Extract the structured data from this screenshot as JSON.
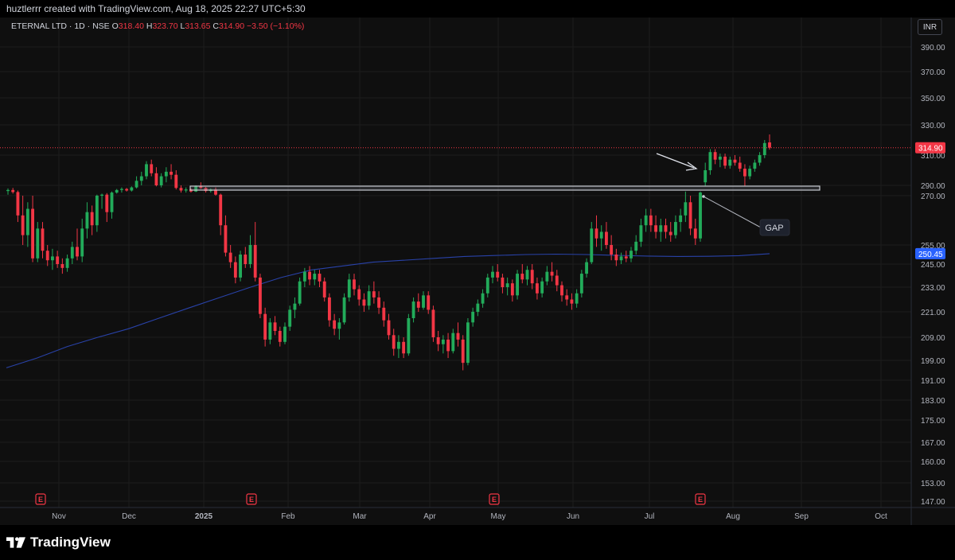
{
  "attribution": "huztlerrr created with TradingView.com, Aug 18, 2025 22:27 UTC+5:30",
  "legend": {
    "symbol": "ETERNAL LTD · 1D · NSE",
    "o_label": "O",
    "o_value": "318.40",
    "h_label": "H",
    "h_value": "323.70",
    "l_label": "L",
    "l_value": "313.65",
    "c_label": "C",
    "c_value": "314.90",
    "change": "−3.50 (−1.10%)"
  },
  "currency_button": "INR",
  "brand": {
    "name": "TradingView",
    "logo_icon": "tradingview-logo-icon"
  },
  "colors": {
    "up": "#26a69a",
    "up_bright": "#22ab5a",
    "down": "#f23645",
    "ma": "#2962ff",
    "price_label": "#f23645",
    "ma_label": "#2962ff",
    "grid": "#1c1c1c",
    "text": "#b2b5be"
  },
  "chart_data": {
    "type": "candlestick",
    "price_axis": {
      "ticks": [
        390,
        370,
        350,
        330,
        310,
        290,
        270,
        255,
        245,
        233,
        221,
        209,
        199,
        191,
        183,
        175,
        167,
        160,
        153,
        147
      ],
      "tick_labels": [
        "390.00",
        "370.00",
        "350.00",
        "330.00",
        "310.00",
        "290.00",
        "270.00",
        "255.00",
        "245.00",
        "233.00",
        "221.00",
        "209.00",
        "199.00",
        "191.00",
        "183.00",
        "175.00",
        "167.00",
        "160.00",
        "153.00",
        "147.00"
      ],
      "scale": "log"
    },
    "time_axis": {
      "labels": [
        "Nov",
        "Dec",
        "2025",
        "Feb",
        "Mar",
        "Apr",
        "May",
        "Jun",
        "Jul",
        "Aug",
        "Sep",
        "Oct"
      ]
    },
    "last_price": 314.9,
    "last_price_label": "314.90",
    "ma_value": 250.45,
    "ma_label": "250.45",
    "earnings_markers": [
      "E",
      "E",
      "E",
      "E"
    ],
    "annotations": {
      "gap_label": "GAP"
    },
    "candles": [
      {
        "o": 279,
        "h": 284,
        "l": 272,
        "c": 281
      },
      {
        "o": 281,
        "h": 285,
        "l": 274,
        "c": 277
      },
      {
        "o": 277,
        "h": 280,
        "l": 262,
        "c": 264
      },
      {
        "o": 264,
        "h": 270,
        "l": 255,
        "c": 258
      },
      {
        "o": 258,
        "h": 268,
        "l": 254,
        "c": 266
      },
      {
        "o": 266,
        "h": 270,
        "l": 246,
        "c": 248
      },
      {
        "o": 248,
        "h": 262,
        "l": 246,
        "c": 260
      },
      {
        "o": 260,
        "h": 262,
        "l": 248,
        "c": 252
      },
      {
        "o": 252,
        "h": 255,
        "l": 244,
        "c": 247
      },
      {
        "o": 247,
        "h": 253,
        "l": 242,
        "c": 249
      },
      {
        "o": 249,
        "h": 252,
        "l": 243,
        "c": 245
      },
      {
        "o": 245,
        "h": 248,
        "l": 240,
        "c": 243
      },
      {
        "o": 243,
        "h": 250,
        "l": 241,
        "c": 248
      },
      {
        "o": 248,
        "h": 256,
        "l": 245,
        "c": 254
      },
      {
        "o": 254,
        "h": 260,
        "l": 247,
        "c": 249
      },
      {
        "o": 249,
        "h": 263,
        "l": 246,
        "c": 260
      },
      {
        "o": 260,
        "h": 268,
        "l": 257,
        "c": 265
      },
      {
        "o": 265,
        "h": 267,
        "l": 258,
        "c": 261
      },
      {
        "o": 261,
        "h": 272,
        "l": 259,
        "c": 270
      },
      {
        "o": 270,
        "h": 274,
        "l": 266,
        "c": 272
      },
      {
        "o": 272,
        "h": 275,
        "l": 262,
        "c": 265
      },
      {
        "o": 265,
        "h": 278,
        "l": 263,
        "c": 276
      },
      {
        "o": 276,
        "h": 283,
        "l": 274,
        "c": 281
      },
      {
        "o": 281,
        "h": 286,
        "l": 276,
        "c": 283
      },
      {
        "o": 283,
        "h": 285,
        "l": 278,
        "c": 280
      },
      {
        "o": 280,
        "h": 288,
        "l": 278,
        "c": 286
      },
      {
        "o": 286,
        "h": 296,
        "l": 284,
        "c": 293
      },
      {
        "o": 293,
        "h": 299,
        "l": 290,
        "c": 296
      },
      {
        "o": 296,
        "h": 306,
        "l": 294,
        "c": 304
      },
      {
        "o": 304,
        "h": 307,
        "l": 296,
        "c": 298
      },
      {
        "o": 298,
        "h": 302,
        "l": 288,
        "c": 290
      },
      {
        "o": 290,
        "h": 298,
        "l": 286,
        "c": 296
      },
      {
        "o": 296,
        "h": 302,
        "l": 292,
        "c": 299
      },
      {
        "o": 299,
        "h": 304,
        "l": 294,
        "c": 297
      },
      {
        "o": 297,
        "h": 300,
        "l": 282,
        "c": 285
      },
      {
        "o": 285,
        "h": 290,
        "l": 276,
        "c": 280
      },
      {
        "o": 280,
        "h": 286,
        "l": 276,
        "c": 282
      },
      {
        "o": 282,
        "h": 284,
        "l": 276,
        "c": 278
      },
      {
        "o": 278,
        "h": 290,
        "l": 277,
        "c": 288
      },
      {
        "o": 288,
        "h": 292,
        "l": 283,
        "c": 285
      },
      {
        "o": 285,
        "h": 287,
        "l": 276,
        "c": 279
      },
      {
        "o": 279,
        "h": 284,
        "l": 276,
        "c": 282
      },
      {
        "o": 282,
        "h": 286,
        "l": 270,
        "c": 272
      },
      {
        "o": 272,
        "h": 274,
        "l": 258,
        "c": 261
      },
      {
        "o": 261,
        "h": 264,
        "l": 249,
        "c": 251
      },
      {
        "o": 251,
        "h": 255,
        "l": 243,
        "c": 246
      },
      {
        "o": 246,
        "h": 249,
        "l": 235,
        "c": 238
      },
      {
        "o": 238,
        "h": 252,
        "l": 236,
        "c": 250
      },
      {
        "o": 250,
        "h": 254,
        "l": 243,
        "c": 245
      },
      {
        "o": 245,
        "h": 258,
        "l": 243,
        "c": 255
      },
      {
        "o": 255,
        "h": 262,
        "l": 236,
        "c": 238
      },
      {
        "o": 238,
        "h": 240,
        "l": 218,
        "c": 220
      },
      {
        "o": 220,
        "h": 223,
        "l": 205,
        "c": 208
      },
      {
        "o": 208,
        "h": 218,
        "l": 206,
        "c": 216
      },
      {
        "o": 216,
        "h": 219,
        "l": 210,
        "c": 212
      },
      {
        "o": 212,
        "h": 214,
        "l": 205,
        "c": 207
      },
      {
        "o": 207,
        "h": 216,
        "l": 206,
        "c": 214
      },
      {
        "o": 214,
        "h": 224,
        "l": 212,
        "c": 222
      },
      {
        "o": 222,
        "h": 228,
        "l": 218,
        "c": 225
      },
      {
        "o": 225,
        "h": 238,
        "l": 224,
        "c": 236
      },
      {
        "o": 236,
        "h": 243,
        "l": 233,
        "c": 241
      },
      {
        "o": 241,
        "h": 244,
        "l": 234,
        "c": 237
      },
      {
        "o": 237,
        "h": 242,
        "l": 234,
        "c": 240
      },
      {
        "o": 240,
        "h": 242,
        "l": 233,
        "c": 236
      },
      {
        "o": 236,
        "h": 238,
        "l": 226,
        "c": 228
      },
      {
        "o": 228,
        "h": 230,
        "l": 214,
        "c": 217
      },
      {
        "o": 217,
        "h": 220,
        "l": 210,
        "c": 213
      },
      {
        "o": 213,
        "h": 218,
        "l": 208,
        "c": 216
      },
      {
        "o": 216,
        "h": 230,
        "l": 215,
        "c": 228
      },
      {
        "o": 228,
        "h": 240,
        "l": 226,
        "c": 237
      },
      {
        "o": 237,
        "h": 240,
        "l": 229,
        "c": 232
      },
      {
        "o": 232,
        "h": 234,
        "l": 224,
        "c": 227
      },
      {
        "o": 227,
        "h": 230,
        "l": 221,
        "c": 224
      },
      {
        "o": 224,
        "h": 234,
        "l": 222,
        "c": 231
      },
      {
        "o": 231,
        "h": 236,
        "l": 225,
        "c": 228
      },
      {
        "o": 228,
        "h": 231,
        "l": 220,
        "c": 223
      },
      {
        "o": 223,
        "h": 226,
        "l": 214,
        "c": 217
      },
      {
        "o": 217,
        "h": 220,
        "l": 208,
        "c": 210
      },
      {
        "o": 210,
        "h": 213,
        "l": 201,
        "c": 204
      },
      {
        "o": 204,
        "h": 210,
        "l": 200,
        "c": 207
      },
      {
        "o": 207,
        "h": 209,
        "l": 200,
        "c": 202
      },
      {
        "o": 202,
        "h": 220,
        "l": 201,
        "c": 218
      },
      {
        "o": 218,
        "h": 228,
        "l": 216,
        "c": 226
      },
      {
        "o": 226,
        "h": 230,
        "l": 221,
        "c": 223
      },
      {
        "o": 223,
        "h": 231,
        "l": 222,
        "c": 229
      },
      {
        "o": 229,
        "h": 231,
        "l": 220,
        "c": 222
      },
      {
        "o": 222,
        "h": 224,
        "l": 207,
        "c": 209
      },
      {
        "o": 209,
        "h": 212,
        "l": 203,
        "c": 206
      },
      {
        "o": 206,
        "h": 210,
        "l": 202,
        "c": 208
      },
      {
        "o": 208,
        "h": 211,
        "l": 200,
        "c": 203
      },
      {
        "o": 203,
        "h": 213,
        "l": 202,
        "c": 211
      },
      {
        "o": 211,
        "h": 216,
        "l": 205,
        "c": 208
      },
      {
        "o": 208,
        "h": 210,
        "l": 195,
        "c": 198
      },
      {
        "o": 198,
        "h": 218,
        "l": 197,
        "c": 216
      },
      {
        "o": 216,
        "h": 223,
        "l": 214,
        "c": 221
      },
      {
        "o": 221,
        "h": 227,
        "l": 219,
        "c": 225
      },
      {
        "o": 225,
        "h": 232,
        "l": 223,
        "c": 230
      },
      {
        "o": 230,
        "h": 240,
        "l": 228,
        "c": 238
      },
      {
        "o": 238,
        "h": 244,
        "l": 235,
        "c": 241
      },
      {
        "o": 241,
        "h": 245,
        "l": 236,
        "c": 238
      },
      {
        "o": 238,
        "h": 240,
        "l": 230,
        "c": 233
      },
      {
        "o": 233,
        "h": 238,
        "l": 229,
        "c": 235
      },
      {
        "o": 235,
        "h": 237,
        "l": 226,
        "c": 229
      },
      {
        "o": 229,
        "h": 242,
        "l": 227,
        "c": 240
      },
      {
        "o": 240,
        "h": 245,
        "l": 235,
        "c": 237
      },
      {
        "o": 237,
        "h": 244,
        "l": 234,
        "c": 242
      },
      {
        "o": 242,
        "h": 245,
        "l": 232,
        "c": 235
      },
      {
        "o": 235,
        "h": 238,
        "l": 227,
        "c": 230
      },
      {
        "o": 230,
        "h": 238,
        "l": 228,
        "c": 236
      },
      {
        "o": 236,
        "h": 244,
        "l": 234,
        "c": 241
      },
      {
        "o": 241,
        "h": 246,
        "l": 236,
        "c": 239
      },
      {
        "o": 239,
        "h": 242,
        "l": 231,
        "c": 234
      },
      {
        "o": 234,
        "h": 236,
        "l": 226,
        "c": 229
      },
      {
        "o": 229,
        "h": 232,
        "l": 224,
        "c": 227
      },
      {
        "o": 227,
        "h": 230,
        "l": 222,
        "c": 225
      },
      {
        "o": 225,
        "h": 232,
        "l": 223,
        "c": 230
      },
      {
        "o": 230,
        "h": 242,
        "l": 228,
        "c": 240
      },
      {
        "o": 240,
        "h": 248,
        "l": 238,
        "c": 246
      },
      {
        "o": 246,
        "h": 262,
        "l": 245,
        "c": 260
      },
      {
        "o": 260,
        "h": 264,
        "l": 254,
        "c": 257
      },
      {
        "o": 257,
        "h": 261,
        "l": 252,
        "c": 259
      },
      {
        "o": 259,
        "h": 262,
        "l": 253,
        "c": 255
      },
      {
        "o": 255,
        "h": 258,
        "l": 247,
        "c": 250
      },
      {
        "o": 250,
        "h": 253,
        "l": 244,
        "c": 247
      },
      {
        "o": 247,
        "h": 251,
        "l": 245,
        "c": 249
      },
      {
        "o": 249,
        "h": 252,
        "l": 246,
        "c": 248
      },
      {
        "o": 248,
        "h": 254,
        "l": 246,
        "c": 252
      },
      {
        "o": 252,
        "h": 258,
        "l": 250,
        "c": 256
      },
      {
        "o": 256,
        "h": 263,
        "l": 254,
        "c": 261
      },
      {
        "o": 261,
        "h": 266,
        "l": 259,
        "c": 264
      },
      {
        "o": 264,
        "h": 266,
        "l": 259,
        "c": 261
      },
      {
        "o": 261,
        "h": 264,
        "l": 257,
        "c": 259
      },
      {
        "o": 259,
        "h": 263,
        "l": 256,
        "c": 261
      },
      {
        "o": 261,
        "h": 263,
        "l": 257,
        "c": 259
      },
      {
        "o": 259,
        "h": 262,
        "l": 256,
        "c": 258
      },
      {
        "o": 258,
        "h": 264,
        "l": 257,
        "c": 262
      },
      {
        "o": 262,
        "h": 266,
        "l": 259,
        "c": 264
      },
      {
        "o": 264,
        "h": 278,
        "l": 262,
        "c": 268
      },
      {
        "o": 268,
        "h": 270,
        "l": 258,
        "c": 260
      },
      {
        "o": 260,
        "h": 263,
        "l": 255,
        "c": 257
      },
      {
        "o": 257,
        "h": 278,
        "l": 256,
        "c": 276
      },
      {
        "o": 292,
        "h": 305,
        "l": 288,
        "c": 300
      },
      {
        "o": 300,
        "h": 314,
        "l": 297,
        "c": 312
      },
      {
        "o": 312,
        "h": 314,
        "l": 304,
        "c": 307
      },
      {
        "o": 307,
        "h": 311,
        "l": 302,
        "c": 309
      },
      {
        "o": 309,
        "h": 311,
        "l": 301,
        "c": 303
      },
      {
        "o": 303,
        "h": 309,
        "l": 301,
        "c": 307
      },
      {
        "o": 307,
        "h": 310,
        "l": 303,
        "c": 305
      },
      {
        "o": 305,
        "h": 309,
        "l": 299,
        "c": 301
      },
      {
        "o": 301,
        "h": 304,
        "l": 289,
        "c": 296
      },
      {
        "o": 296,
        "h": 303,
        "l": 294,
        "c": 301
      },
      {
        "o": 301,
        "h": 307,
        "l": 299,
        "c": 305
      },
      {
        "o": 305,
        "h": 312,
        "l": 303,
        "c": 310
      },
      {
        "o": 310,
        "h": 320,
        "l": 308,
        "c": 318
      },
      {
        "o": 318.4,
        "h": 323.7,
        "l": 313.65,
        "c": 314.9
      }
    ]
  }
}
